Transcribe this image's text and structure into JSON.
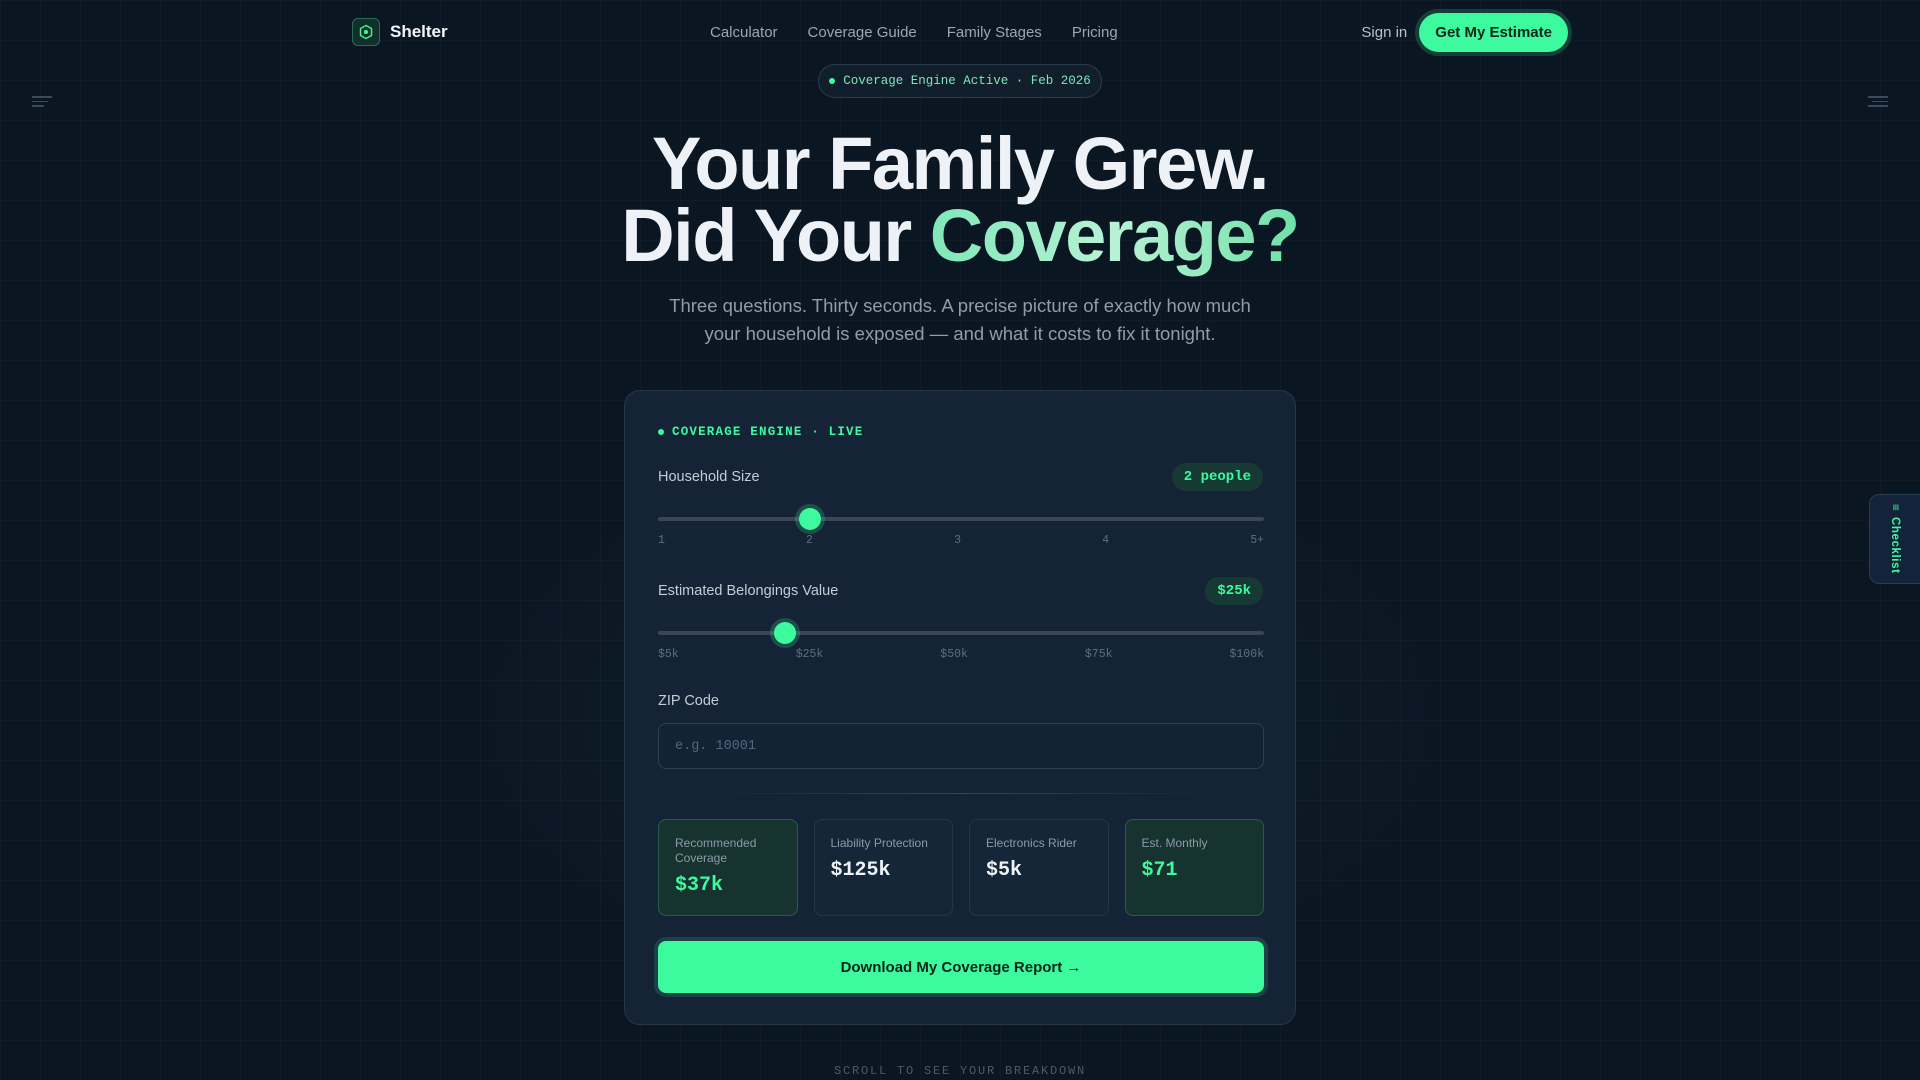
{
  "nav": {
    "brand": "Shelter",
    "links": [
      "Calculator",
      "Coverage Guide",
      "Family Stages",
      "Pricing"
    ],
    "sign_in": "Sign in",
    "cta": "Get My Estimate"
  },
  "status_pill": "Coverage Engine Active · Feb 2026",
  "hero": {
    "line1": "Your Family Grew.",
    "line2_plain": "Did Your ",
    "line2_accent": "Coverage?",
    "subtitle": "Three questions. Thirty seconds. A precise picture of exactly how much your household is exposed — and what it costs to fix it tonight."
  },
  "card": {
    "engine_label": "COVERAGE ENGINE · LIVE",
    "household": {
      "label": "Household Size",
      "value_display": "2 people",
      "value": 2,
      "min": 1,
      "max": 5,
      "ticks": [
        "1",
        "2",
        "3",
        "4",
        "5+"
      ]
    },
    "belongings": {
      "label": "Estimated Belongings Value",
      "value_display": "$25k",
      "value": 0.21,
      "ticks": [
        "$5k",
        "$25k",
        "$50k",
        "$75k",
        "$100k"
      ]
    },
    "zip": {
      "label": "ZIP Code",
      "value": "",
      "placeholder": "e.g. 10001"
    },
    "stats": [
      {
        "label": "Recommended Coverage",
        "value": "$37k",
        "highlight": true
      },
      {
        "label": "Liability Protection",
        "value": "$125k",
        "highlight": false
      },
      {
        "label": "Electronics Rider",
        "value": "$5k",
        "highlight": false
      },
      {
        "label": "Est. Monthly",
        "value": "$71",
        "highlight": true
      }
    ],
    "download_button": "Download My Coverage Report →"
  },
  "scroll_hint": "SCROLL TO SEE YOUR BREAKDOWN",
  "side_tab": "Checklist",
  "colors": {
    "background": "#0b1623",
    "card": "#142436",
    "accent": "#3dfa9e",
    "muted_text": "#8f9cab"
  }
}
